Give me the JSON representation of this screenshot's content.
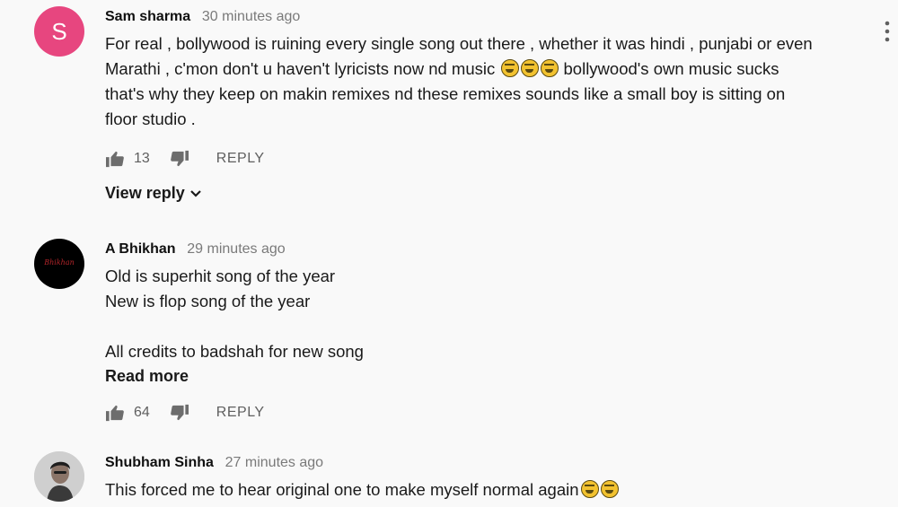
{
  "comments": [
    {
      "author": "Sam sharma",
      "time": "30 minutes ago",
      "avatar_letter": "S",
      "text_lines": [
        "For real , bollywood is ruining every single song out there , whether it was hindi , punjabi or even",
        "Marathi , c'mon don't u haven't lyricists now nd music",
        "bollywood's own music sucks",
        "that's why they keep on makin remixes nd these remixes sounds like a small boy is sitting on",
        "floor studio ."
      ],
      "likes": "13",
      "reply_label": "REPLY",
      "view_reply_label": "View reply"
    },
    {
      "author": "A Bhikhan",
      "time": "29 minutes ago",
      "avatar_logo_text": "Bhikhan",
      "text_lines": [
        "Old is superhit song of the year",
        "New is flop song of the year",
        "",
        "All credits to badshah for new song"
      ],
      "read_more_label": "Read more",
      "likes": "64",
      "reply_label": "REPLY"
    },
    {
      "author": "Shubham Sinha",
      "time": "27 minutes ago",
      "text_lines": [
        "This forced me to hear original one to make myself normal again"
      ]
    }
  ],
  "icons": {
    "like": "thumbs-up-icon",
    "dislike": "thumbs-down-icon",
    "menu": "more-vert-icon",
    "chevron": "chevron-down-icon",
    "emoji": "grinning-sweat-emoji"
  },
  "colors": {
    "background": "#f9f9f9",
    "avatar_s": "#e7467f",
    "meta_text": "#7a7a7a",
    "action_text": "#5f5f5f"
  }
}
